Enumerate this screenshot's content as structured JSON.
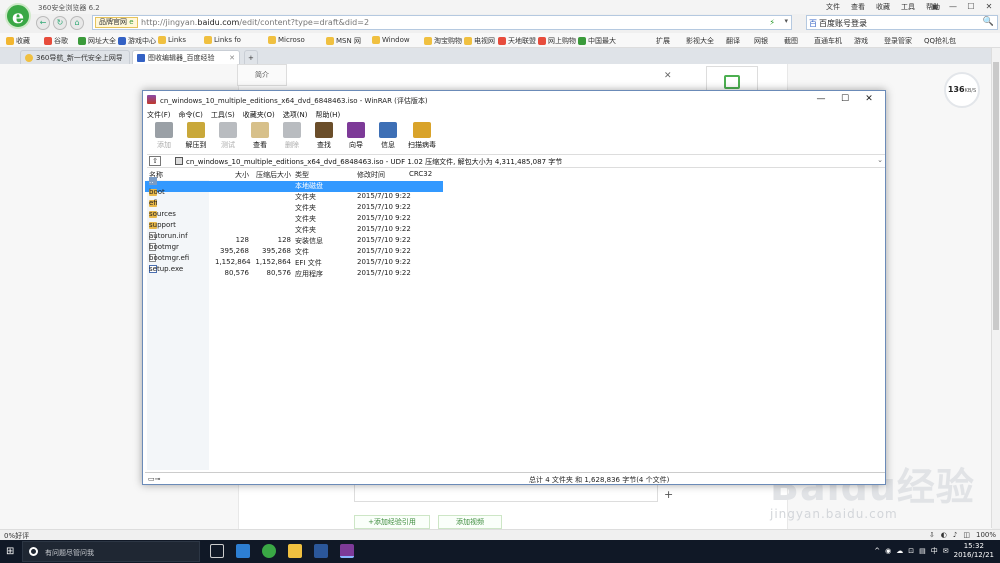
{
  "browser": {
    "title": "360安全浏览器 6.2",
    "logo": "e",
    "title_menu": [
      "文件",
      "查看",
      "收藏",
      "工具",
      "帮助"
    ],
    "controls": [
      "▣",
      "—",
      "☐",
      "✕"
    ],
    "nav": {
      "back": "←",
      "refresh": "↻",
      "home": "⌂"
    },
    "address": {
      "badge": "品牌官网",
      "badge_mark": "e",
      "url_prefix": "http://jingyan.",
      "url_domain": "baidu.com",
      "url_rest": "/edit/content?type=draft&did=2",
      "bolt": "⚡",
      "dropdown": "▾"
    },
    "search": {
      "engine_icon": "百",
      "value": "百度账号登录",
      "button": "🔍"
    },
    "favorites": [
      {
        "label": "收藏",
        "color": "#f2b630"
      },
      {
        "label": "谷歌",
        "color": "#e74c3c"
      },
      {
        "label": "网址大全",
        "color": "#3a9a3a"
      },
      {
        "label": "游戏中心",
        "color": "#3361c4"
      },
      {
        "label": "Links",
        "color": "#f0c040"
      },
      {
        "label": "Links fo",
        "color": "#f0c040"
      },
      {
        "label": "Microso",
        "color": "#f0c040"
      },
      {
        "label": "MSN 网",
        "color": "#f0c040"
      },
      {
        "label": "Window",
        "color": "#f0c040"
      },
      {
        "label": "淘宝购物",
        "color": "#f0c040"
      },
      {
        "label": "电视网",
        "color": "#f0c040"
      },
      {
        "label": "天地联盟",
        "color": "#e74c3c"
      },
      {
        "label": "网上购物",
        "color": "#e74c3c"
      },
      {
        "label": "中国最大",
        "color": "#3a9a3a"
      }
    ],
    "fav_right": [
      "扩展",
      "影视大全",
      "翻译",
      "网银",
      "截图",
      "直通车机",
      "游戏",
      "登录管家",
      "QQ抢礼包"
    ],
    "tabs": [
      {
        "label": "360导航_新一代安全上网导航",
        "active": false
      },
      {
        "label": "图收编辑器_百度经验",
        "active": true
      }
    ],
    "new_tab": "+"
  },
  "page": {
    "intro_label": "简介",
    "close": "✕",
    "speed_value": "136",
    "speed_unit": "KB/S",
    "plus": "+",
    "add_reference": "+添加经验引用",
    "add_video": "添加视频",
    "watermark_big": "Baidu经验",
    "watermark_small": "jingyan.baidu.com"
  },
  "winrar": {
    "title": "cn_windows_10_multiple_editions_x64_dvd_6848463.iso - WinRAR (评估版本)",
    "controls": [
      "—",
      "☐",
      "✕"
    ],
    "menu": [
      "文件(F)",
      "命令(C)",
      "工具(S)",
      "收藏夹(O)",
      "选项(N)",
      "帮助(H)"
    ],
    "tools": [
      {
        "label": "添加",
        "color": "#9aa0a6",
        "enabled": false
      },
      {
        "label": "解压到",
        "color": "#c9a83a",
        "enabled": true
      },
      {
        "label": "测试",
        "color": "#b9bcc0",
        "enabled": false
      },
      {
        "label": "查看",
        "color": "#d7c08a",
        "enabled": true
      },
      {
        "label": "删除",
        "color": "#b9bcc0",
        "enabled": false
      },
      {
        "label": "查找",
        "color": "#6b4e2a",
        "enabled": true
      },
      {
        "label": "向导",
        "color": "#7d3a98",
        "enabled": true
      },
      {
        "label": "信息",
        "color": "#3d6fb5",
        "enabled": true
      },
      {
        "label": "扫描病毒",
        "color": "#d9a32a",
        "enabled": true
      }
    ],
    "path": "cn_windows_10_multiple_editions_x64_dvd_6848463.iso - UDF 1.02 压缩文件, 解包大小为 4,311,485,087 字节",
    "up_button": "⇧",
    "path_dropdown": "⌄",
    "columns": {
      "name": "名称",
      "size": "大小",
      "packed": "压缩后大小",
      "type": "类型",
      "modified": "修改时间",
      "crc": "CRC32"
    },
    "files": [
      {
        "name": "..",
        "size": "",
        "packed": "",
        "type": "本地磁盘",
        "modified": "",
        "icon": "up",
        "selected": true
      },
      {
        "name": "boot",
        "size": "",
        "packed": "",
        "type": "文件夹",
        "modified": "2015/7/10 9:22",
        "icon": "folder",
        "selected": false
      },
      {
        "name": "efi",
        "size": "",
        "packed": "",
        "type": "文件夹",
        "modified": "2015/7/10 9:22",
        "icon": "folder",
        "selected": false
      },
      {
        "name": "sources",
        "size": "",
        "packed": "",
        "type": "文件夹",
        "modified": "2015/7/10 9:22",
        "icon": "folder",
        "selected": false
      },
      {
        "name": "support",
        "size": "",
        "packed": "",
        "type": "文件夹",
        "modified": "2015/7/10 9:22",
        "icon": "folder",
        "selected": false
      },
      {
        "name": "autorun.inf",
        "size": "128",
        "packed": "128",
        "type": "安装信息",
        "modified": "2015/7/10 9:22",
        "icon": "file",
        "selected": false
      },
      {
        "name": "bootmgr",
        "size": "395,268",
        "packed": "395,268",
        "type": "文件",
        "modified": "2015/7/10 9:22",
        "icon": "file",
        "selected": false
      },
      {
        "name": "bootmgr.efi",
        "size": "1,152,864",
        "packed": "1,152,864",
        "type": "EFI 文件",
        "modified": "2015/7/10 9:22",
        "icon": "file",
        "selected": false
      },
      {
        "name": "setup.exe",
        "size": "80,576",
        "packed": "80,576",
        "type": "应用程序",
        "modified": "2015/7/10 9:22",
        "icon": "exe",
        "selected": false
      }
    ],
    "status_key": "▭⊸",
    "status": "总计 4 文件夹 和 1,628,836 字节(4 个文件)"
  },
  "status_bar": {
    "left": "0%好评",
    "zoom": "100%",
    "icons": [
      "⇩",
      "◐",
      "♪",
      "◫"
    ]
  },
  "taskbar": {
    "start": "⊞",
    "search_placeholder": "有问题尽管问我",
    "tray_text": [
      "^",
      "◉",
      "☁",
      "⊡",
      "▤",
      "中",
      "✉"
    ],
    "time": "15:32",
    "date": "2016/12/21"
  }
}
